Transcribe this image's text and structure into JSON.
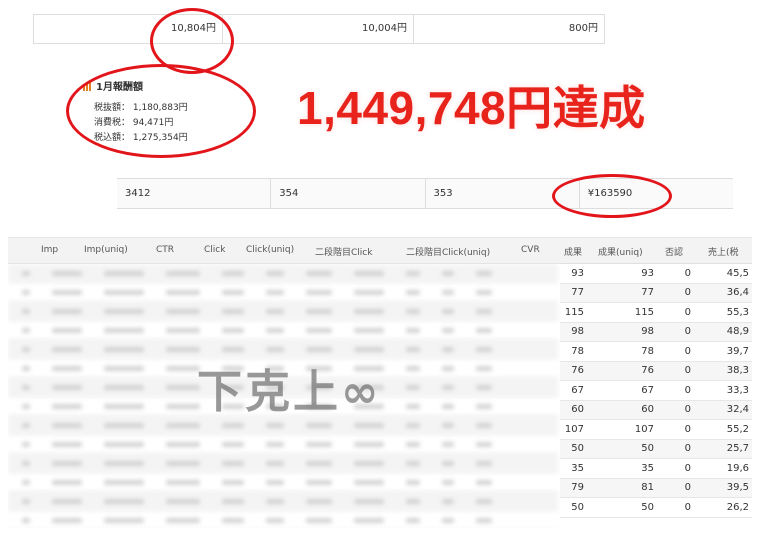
{
  "top_row": {
    "cells": [
      "10,804円",
      "10,004円",
      "800円"
    ]
  },
  "earnings": {
    "title": "1月報酬額",
    "lines": [
      "税抜額： 1,180,883円",
      "消費税： 94,471円",
      "税込額： 1,275,354円"
    ]
  },
  "headline": "1,449,748円達成",
  "mid_row": {
    "cells": [
      "3412",
      "354",
      "353",
      "¥163590"
    ]
  },
  "table": {
    "headers": [
      "Imp",
      "Imp(uniq)",
      "CTR",
      "Click",
      "Click(uniq)",
      "二段階目Click",
      "二段階目Click(uniq)",
      "CVR",
      "成果",
      "成果(uniq)",
      "否認",
      "売上(税"
    ],
    "rows": [
      [
        "93",
        "93",
        "0",
        "45,5"
      ],
      [
        "77",
        "77",
        "0",
        "36,4"
      ],
      [
        "115",
        "115",
        "0",
        "55,3"
      ],
      [
        "98",
        "98",
        "0",
        "48,9"
      ],
      [
        "78",
        "78",
        "0",
        "39,7"
      ],
      [
        "76",
        "76",
        "0",
        "38,3"
      ],
      [
        "67",
        "67",
        "0",
        "33,3"
      ],
      [
        "60",
        "60",
        "0",
        "32,4"
      ],
      [
        "107",
        "107",
        "0",
        "55,2"
      ],
      [
        "50",
        "50",
        "0",
        "25,7"
      ],
      [
        "35",
        "35",
        "0",
        "19,6"
      ],
      [
        "79",
        "81",
        "0",
        "39,5"
      ],
      [
        "50",
        "50",
        "0",
        "26,2"
      ]
    ]
  },
  "watermark": "下克上∞",
  "colors": {
    "highlight": "#e2151b",
    "headline": "#e8231b",
    "icon_orange": "#e67e22"
  }
}
